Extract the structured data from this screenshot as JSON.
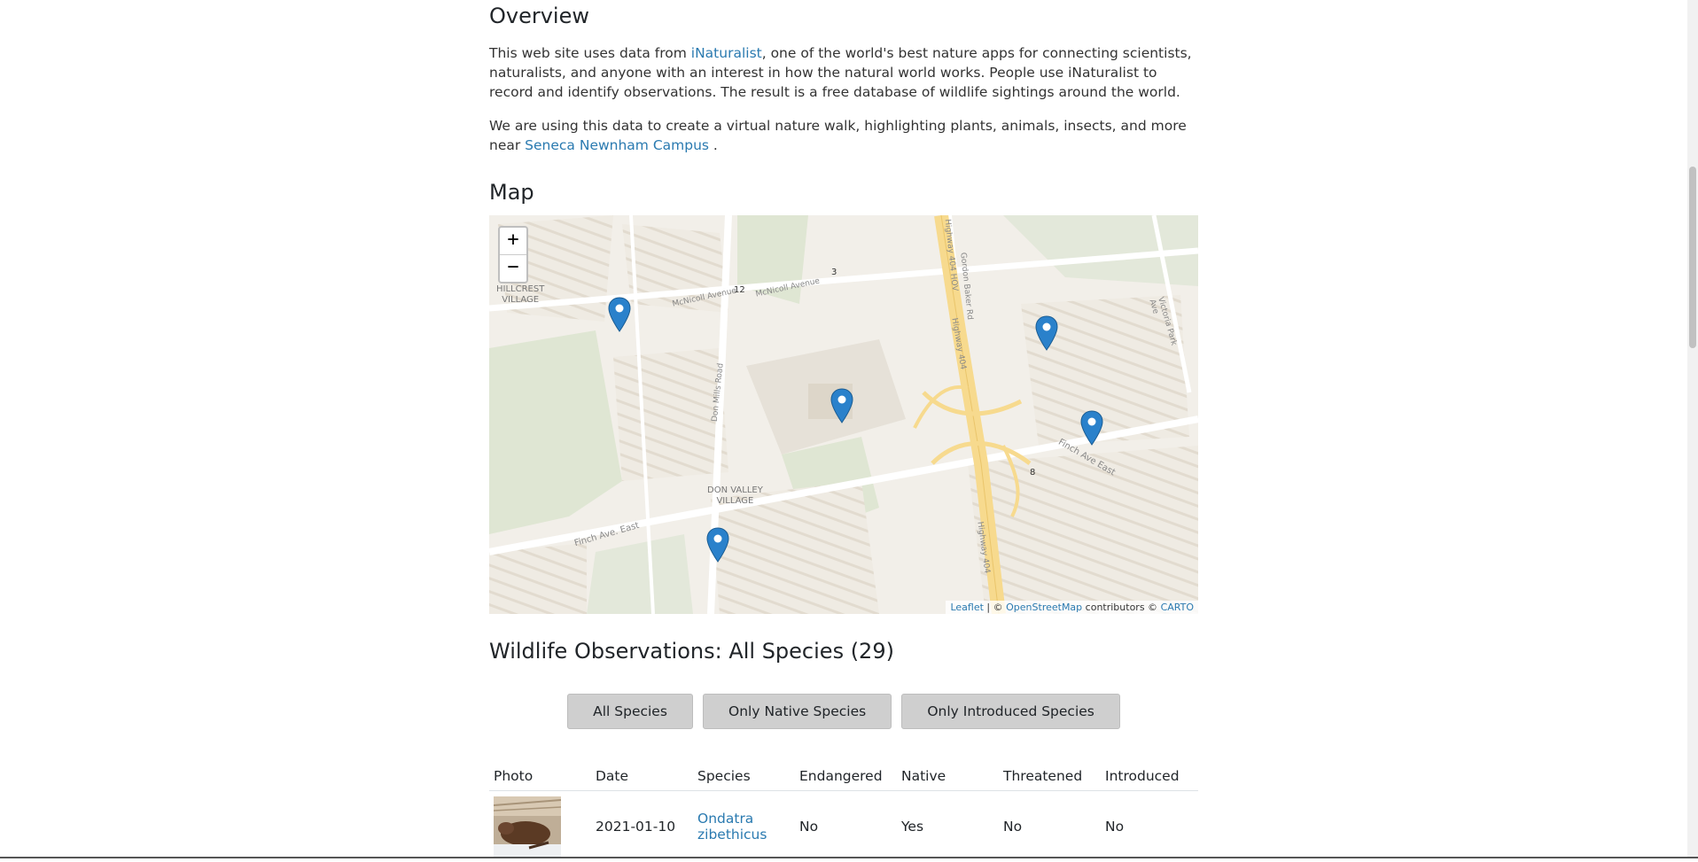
{
  "overview": {
    "heading": "Overview",
    "p1_before": "This web site uses data from ",
    "p1_link": "iNaturalist",
    "p1_after": ", one of the world's best nature apps for connecting scientists, naturalists, and anyone with an interest in how the natural world works. People use iNaturalist to record and identify observations. The result is a free database of wildlife sightings around the world.",
    "p2_before": "We are using this data to create a virtual nature walk, highlighting plants, animals, insects, and more near ",
    "p2_link": "Seneca Newnham Campus",
    "p2_after": " ."
  },
  "map": {
    "heading": "Map",
    "zoom_in": "+",
    "zoom_out": "−",
    "labels": {
      "hillcrest": "HILLCREST\nVILLAGE",
      "don_valley": "DON VALLEY\nVILLAGE",
      "mcnicoll_w": "McNicoll Avenue",
      "mcnicoll_e": "McNicoll Avenue",
      "don_mills": "Don Mills Road",
      "finch_w": "Finch Ave. East",
      "finch_e": "Finch Ave East",
      "hwy404_hov": "Highway 404 HOV",
      "hwy404_a": "Highway 404",
      "hwy404_b": "Highway 404",
      "gordon": "Gordon Baker Rd",
      "victoria": "Victoria Park Ave",
      "n12": "12",
      "n3": "3",
      "n8": "8"
    },
    "attrib_leaflet": "Leaflet",
    "attrib_sep": " | © ",
    "attrib_osm": "OpenStreetMap",
    "attrib_mid": " contributors © ",
    "attrib_carto": "CARTO",
    "marker_color": "#2a81cb",
    "markers": 5
  },
  "observations": {
    "heading": "Wildlife Observations: All Species (29)",
    "filters": [
      "All Species",
      "Only Native Species",
      "Only Introduced Species"
    ],
    "columns": [
      "Photo",
      "Date",
      "Species",
      "Endangered",
      "Native",
      "Threatened",
      "Introduced"
    ],
    "rows": [
      {
        "photo": "muskrat-photo",
        "date": "2021-01-10",
        "species": "Ondatra zibethicus",
        "endangered": "No",
        "native": "Yes",
        "threatened": "No",
        "introduced": "No"
      }
    ]
  }
}
